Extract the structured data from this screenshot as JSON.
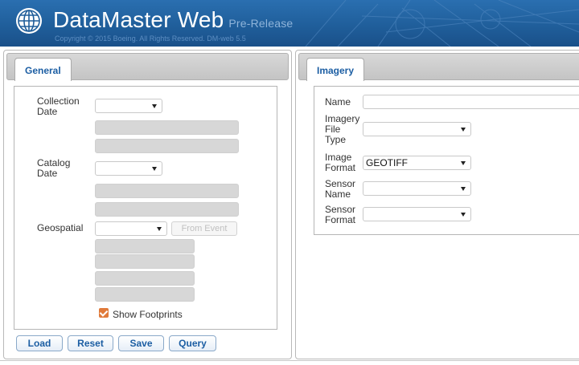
{
  "header": {
    "app_title": "DataMaster Web",
    "release_tag": "Pre-Release",
    "copyright": "Copyright © 2015 Boeing. All Rights Reserved. DM-web 5.5",
    "logo_icon": "globe-icon"
  },
  "left_panel": {
    "tab_label": "General",
    "collection_date_label": "Collection Date",
    "collection_date_value": "",
    "catalog_date_label": "Catalog Date",
    "catalog_date_value": "",
    "geospatial_label": "Geospatial",
    "geospatial_value": "",
    "from_event_label": "From Event",
    "show_footprints_label": "Show Footprints",
    "show_footprints_checked": true
  },
  "right_panel": {
    "tab_label": "Imagery",
    "name_label": "Name",
    "name_value": "",
    "imagery_file_type_label": "Imagery File Type",
    "imagery_file_type_value": "",
    "image_format_label": "Image Format",
    "image_format_value": "GEOTIFF",
    "sensor_name_label": "Sensor Name",
    "sensor_name_value": "",
    "sensor_format_label": "Sensor Format",
    "sensor_format_value": ""
  },
  "actions": {
    "load": "Load",
    "reset": "Reset",
    "save": "Save",
    "query": "Query"
  },
  "colors": {
    "header_blue": "#1f5d99",
    "accent_text": "#1c5ea3",
    "checkbox": "#e07a3a"
  }
}
